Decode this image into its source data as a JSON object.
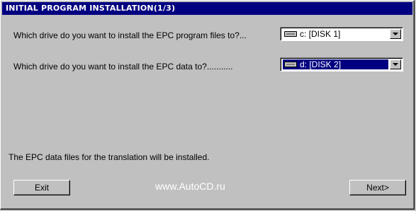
{
  "window": {
    "title": "INITIAL PROGRAM INSTALLATION(1/3)"
  },
  "questions": [
    {
      "label": "Which drive do you want to install the EPC program files to?..."
    },
    {
      "label": "Which drive do you want to install the EPC data to?..........."
    }
  ],
  "drives": [
    {
      "selected_value": "c: [DISK 1]",
      "icon": "drive-icon"
    },
    {
      "selected_value": "d: [DISK 2]",
      "icon": "drive-icon"
    }
  ],
  "info_text": "The EPC data files for the translation will be installed.",
  "buttons": {
    "exit_label": "Exit",
    "next_label": "Next>"
  },
  "watermark": "www.AutoCD.ru"
}
